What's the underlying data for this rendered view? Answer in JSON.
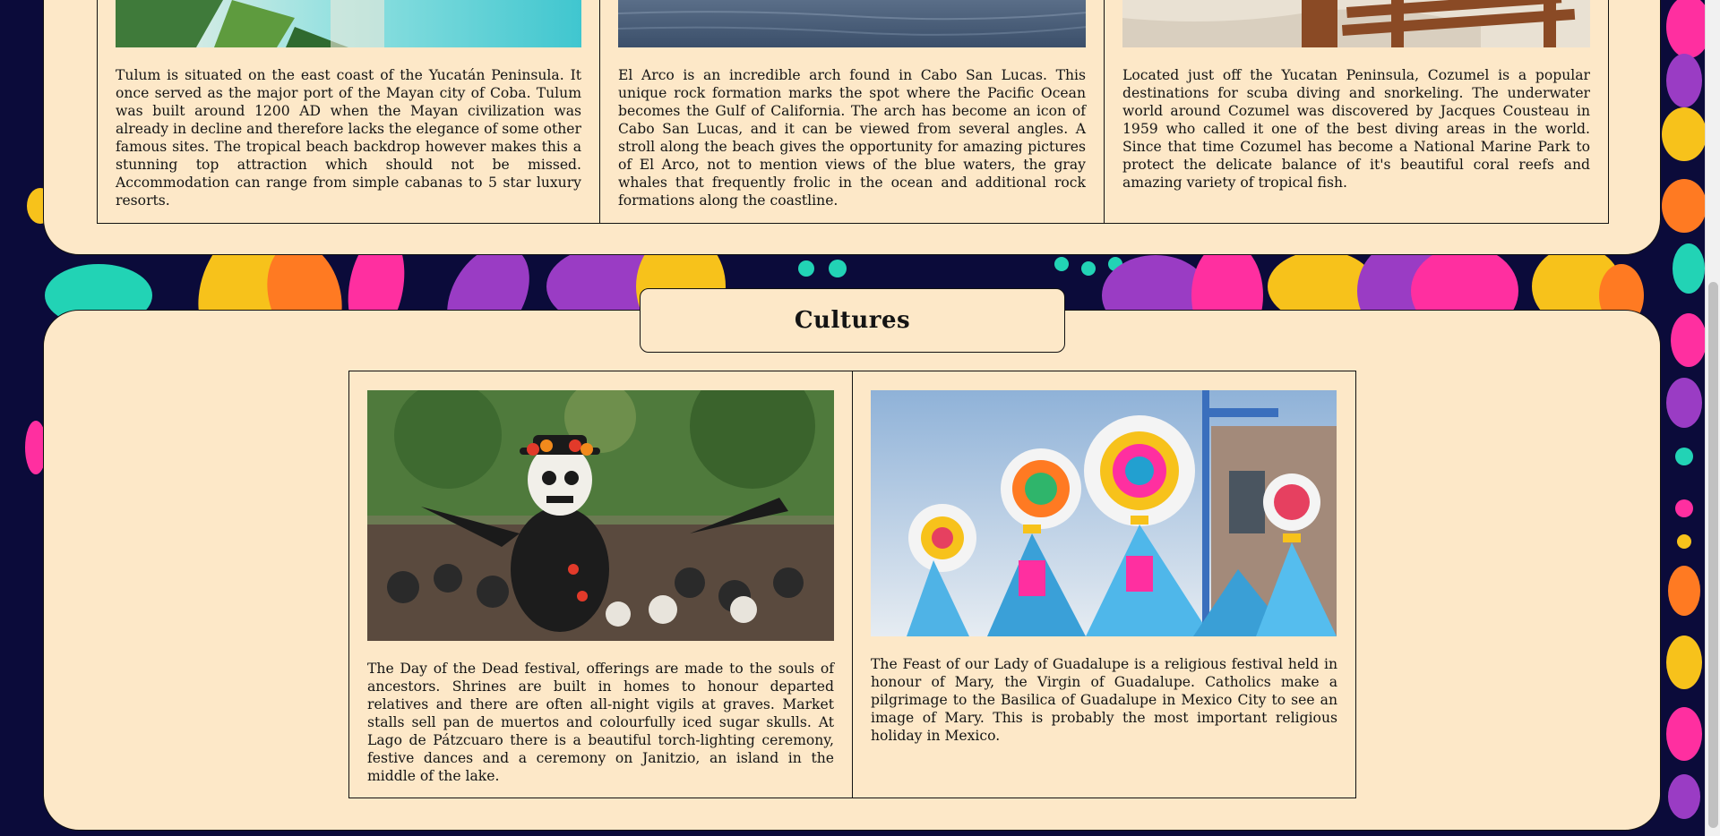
{
  "destinations": {
    "tulum": {
      "image_icon": "tulum-beach-photo",
      "text": "Tulum is situated on the east coast of the Yucatán Peninsula. It once served as the major port of the Mayan city of Coba. Tulum was built around 1200 AD when the Mayan civilization was already in decline and therefore lacks the elegance of some other famous sites. The tropical beach backdrop however makes this a stunning top attraction which should not be missed. Accommodation can range from simple cabanas to 5 star luxury resorts."
    },
    "el_arco": {
      "image_icon": "el-arco-ocean-photo",
      "text": "El Arco is an incredible arch found in Cabo San Lucas. This unique rock formation marks the spot where the Pacific Ocean becomes the Gulf of California. The arch has become an icon of Cabo San Lucas, and it can be viewed from several angles. A stroll along the beach gives the opportunity for amazing pictures of El Arco, not to mention views of the blue waters, the gray whales that frequently frolic in the ocean and additional rock formations along the coastline."
    },
    "cozumel": {
      "image_icon": "cozumel-beach-chairs-photo",
      "text": "Located just off the Yucatan Peninsula, Cozumel is a popular destinations for scuba diving and snorkeling. The underwater world around Cozumel was discovered by Jacques Cousteau in 1959 who called it one of the best diving areas in the world. Since that time Cozumel has become a National Marine Park to protect the delicate balance of it's beautiful coral reefs and amazing variety of tropical fish."
    }
  },
  "cultures": {
    "heading": "Cultures",
    "day_of_dead": {
      "image_icon": "day-of-the-dead-parade-photo",
      "text": "The Day of the Dead festival, offerings are made to the souls of ancestors. Shrines are built in homes to honour departed relatives and there are often all-night vigils at graves. Market stalls sell pan de muertos and colourfully iced sugar skulls. At Lago de Pátzcuaro there is a beautiful torch-lighting ceremony, festive dances and a ceremony on Janitzio, an island in the middle of the lake."
    },
    "guadalupe": {
      "image_icon": "guadalupe-feast-dancers-photo",
      "text": "The Feast of our Lady of Guadalupe is a religious festival held in honour of Mary, the Virgin of Guadalupe. Catholics make a pilgrimage to the Basilica of Guadalupe in Mexico City to see an image of Mary. This is probably the most important religious holiday in Mexico."
    }
  },
  "colors": {
    "page_background": "#0b0b3a",
    "panel_background": "#fde8c8",
    "border": "#111111",
    "pattern_pink": "#ff2fa0",
    "pattern_yellow": "#f7c21b",
    "pattern_orange": "#ff7a22",
    "pattern_teal": "#22d3b5",
    "pattern_purple": "#9a3cc4"
  }
}
